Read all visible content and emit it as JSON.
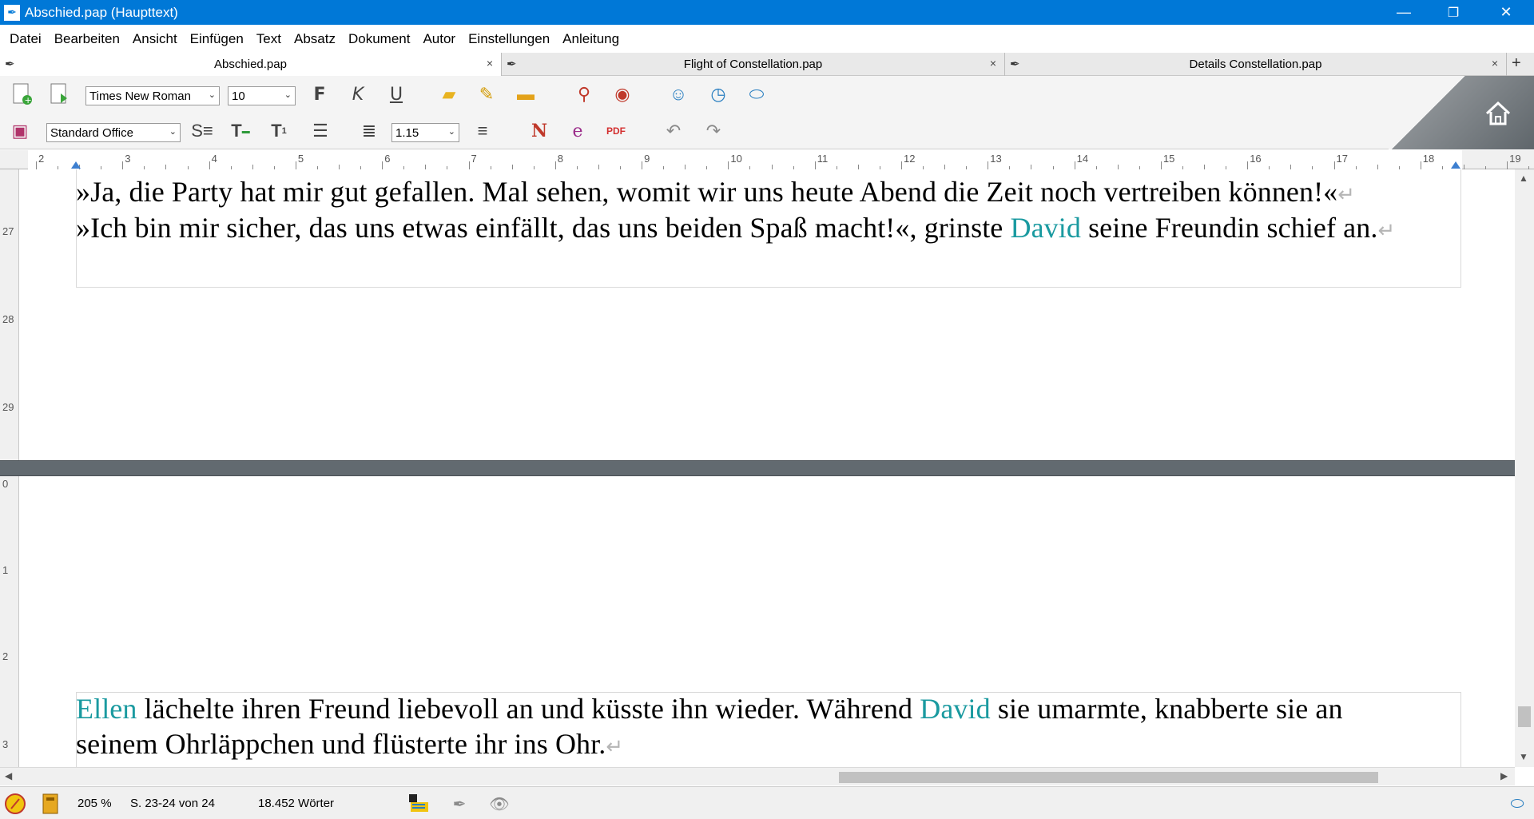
{
  "window": {
    "title": "Abschied.pap  (Haupttext)",
    "minimize": "—",
    "maximize": "❐",
    "close": "✕"
  },
  "menu": [
    "Datei",
    "Bearbeiten",
    "Ansicht",
    "Einfügen",
    "Text",
    "Absatz",
    "Dokument",
    "Autor",
    "Einstellungen",
    "Anleitung"
  ],
  "tabs": [
    {
      "label": "Abschied.pap",
      "active": true
    },
    {
      "label": "Flight of Constellation.pap",
      "active": false
    },
    {
      "label": "Details Constellation.pap",
      "active": false
    }
  ],
  "tab_close": "×",
  "tab_add": "+",
  "toolbar": {
    "font_family": "Times New Roman",
    "font_size": "10",
    "style": "Standard Office",
    "line_spacing": "1.15",
    "bold_label": "F",
    "italic_label": "K",
    "underline_label": "U"
  },
  "ruler": [
    "2",
    "3",
    "4",
    "5",
    "6",
    "7",
    "8",
    "9",
    "10",
    "11",
    "12",
    "13",
    "14",
    "15",
    "16",
    "17",
    "18",
    "19"
  ],
  "vruler_top": [
    "27",
    "28",
    "29"
  ],
  "vruler_bottom": [
    "0",
    "1",
    "2",
    "3"
  ],
  "doc_top": {
    "line1": "»Ja, die Party hat mir gut gefallen. Mal sehen, womit wir uns heute Abend die Zeit noch vertreiben können!«",
    "line2_a": "»Ich bin mir sicher, das uns etwas einfällt, das uns beiden Spaß macht!«, grinste ",
    "line2_name": "David",
    "line2_b": " seine Freundin schief an."
  },
  "doc_bottom": {
    "line1_name1": "Ellen",
    "line1_a": " lächelte ihren Freund liebevoll an und küsste ihn wieder. Während ",
    "line1_name2": "David",
    "line1_b": " sie umarmte, knabberte sie an",
    "line2": "seinem Ohrläppchen und flüsterte ihr ins Ohr."
  },
  "para_mark": "↵",
  "status": {
    "zoom": "205 %",
    "pages": "S. 23-24 von 24",
    "words": "18.452 Wörter"
  },
  "colors": {
    "titlebar": "#0078d7",
    "character_name": "#1a9aa0",
    "splitter": "#626a70"
  }
}
